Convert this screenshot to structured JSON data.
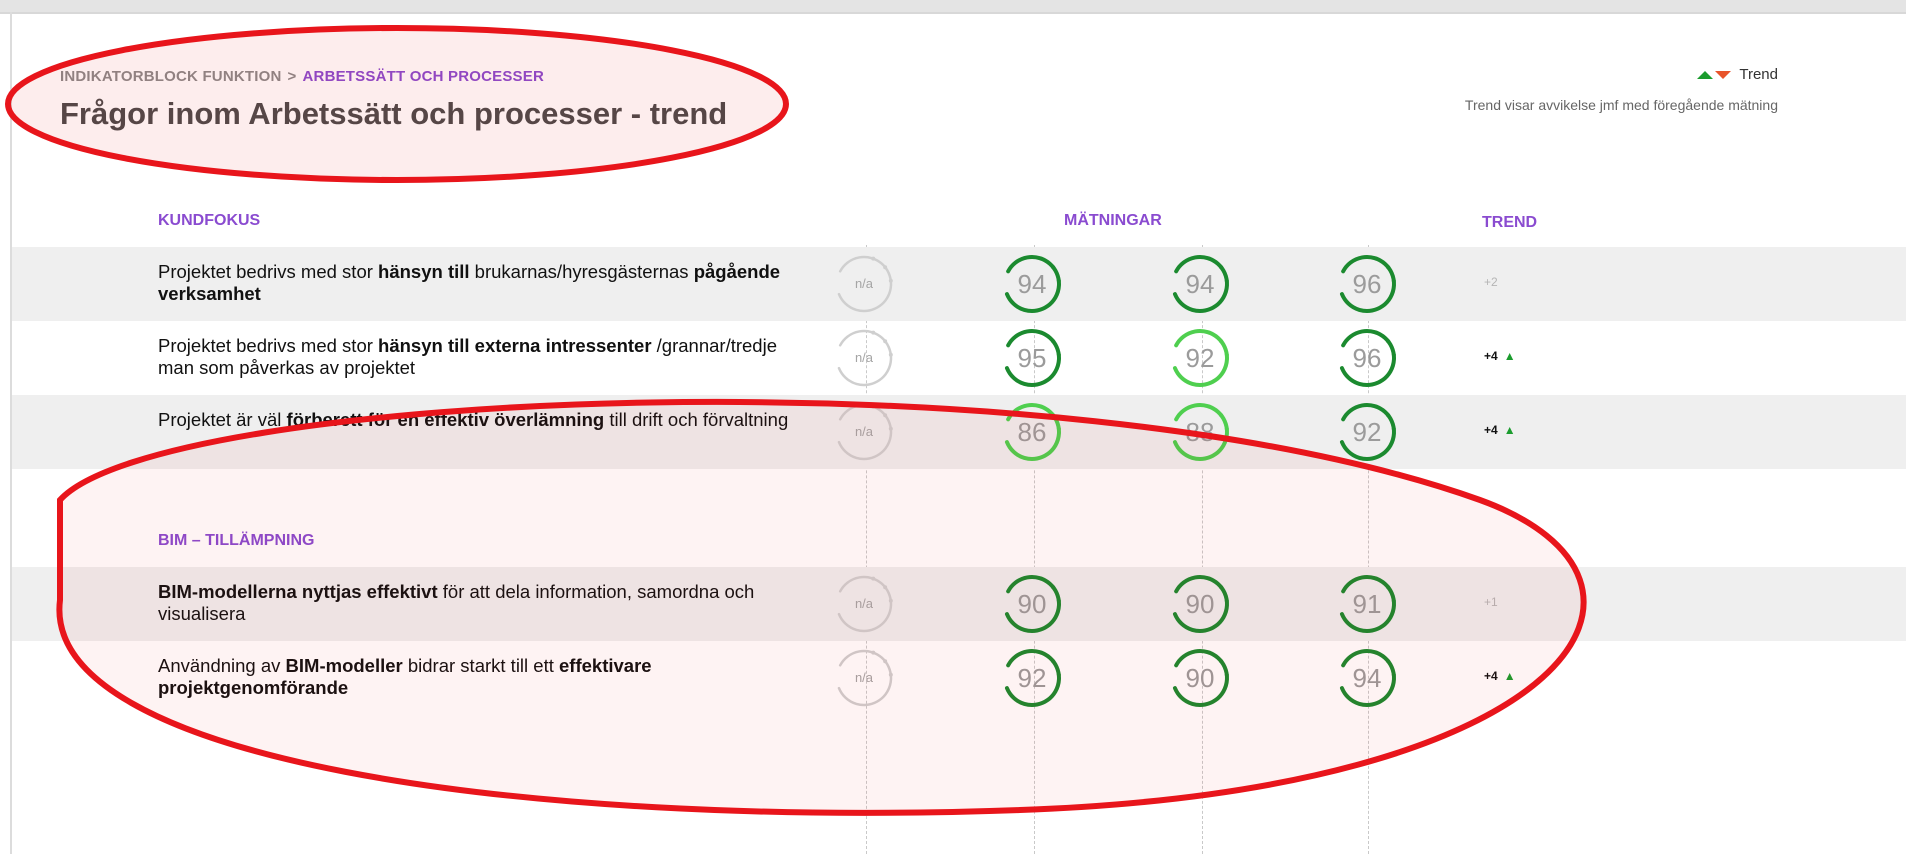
{
  "breadcrumb": {
    "root": "INDIKATORBLOCK FUNKTION",
    "separator": ">",
    "current": "ARBETSSÄTT OCH PROCESSER"
  },
  "page_title": "Frågor inom Arbetssätt och processer - trend",
  "legend": {
    "label": "Trend",
    "note": "Trend visar avvikelse jmf med föregående mätning",
    "up_color": "#1b9c2e",
    "down_color": "#e8542b"
  },
  "columns": {
    "measurements": "MÄTNINGAR",
    "trend": "TREND"
  },
  "colors": {
    "gauge_dark_green": "#1b8a2f",
    "gauge_light_green": "#4fcf4f",
    "na_grey": "#cfcfcf",
    "accent_purple": "#8a4bd0",
    "annotation_red": "#e8151b"
  },
  "sections": [
    {
      "label": "KUNDFOKUS",
      "rows": [
        {
          "parts": [
            [
              "Projektet bedrivs med stor ",
              false
            ],
            [
              "hänsyn till",
              true
            ],
            [
              " brukarnas/hyresgästernas ",
              false
            ],
            [
              "pågående verksamhet",
              true
            ]
          ],
          "scores": [
            "n/a",
            "94",
            "94",
            "96"
          ],
          "tones": [
            "na",
            "dark",
            "dark",
            "dark"
          ],
          "trend": "+2",
          "trend_dir": "none"
        },
        {
          "parts": [
            [
              "Projektet bedrivs med stor ",
              false
            ],
            [
              "hänsyn till externa intressenter",
              true
            ],
            [
              " /grannar/tredje man som påverkas av projektet",
              false
            ]
          ],
          "scores": [
            "n/a",
            "95",
            "92",
            "96"
          ],
          "tones": [
            "na",
            "dark",
            "light",
            "dark"
          ],
          "trend": "+4",
          "trend_dir": "up"
        },
        {
          "parts": [
            [
              "Projektet är väl ",
              false
            ],
            [
              "förberett för en effektiv överlämning",
              true
            ],
            [
              " till drift och förvaltning",
              false
            ]
          ],
          "scores": [
            "n/a",
            "86",
            "88",
            "92"
          ],
          "tones": [
            "na",
            "light",
            "light",
            "dark"
          ],
          "trend": "+4",
          "trend_dir": "up"
        }
      ]
    },
    {
      "label": "BIM – TILLÄMPNING",
      "rows": [
        {
          "parts": [
            [
              "BIM-modellerna nyttjas effektivt",
              true
            ],
            [
              " för att dela information, samordna och visualisera",
              false
            ]
          ],
          "scores": [
            "n/a",
            "90",
            "90",
            "91"
          ],
          "tones": [
            "na",
            "dark",
            "dark",
            "dark"
          ],
          "trend": "+1",
          "trend_dir": "none"
        },
        {
          "parts": [
            [
              "Användning av ",
              false
            ],
            [
              "BIM-modeller",
              true
            ],
            [
              " bidrar starkt till ett ",
              false
            ],
            [
              "effektivare projektgenomförande",
              true
            ]
          ],
          "scores": [
            "n/a",
            "92",
            "90",
            "94"
          ],
          "tones": [
            "na",
            "dark",
            "dark",
            "dark"
          ],
          "trend": "+4",
          "trend_dir": "up"
        }
      ]
    }
  ]
}
